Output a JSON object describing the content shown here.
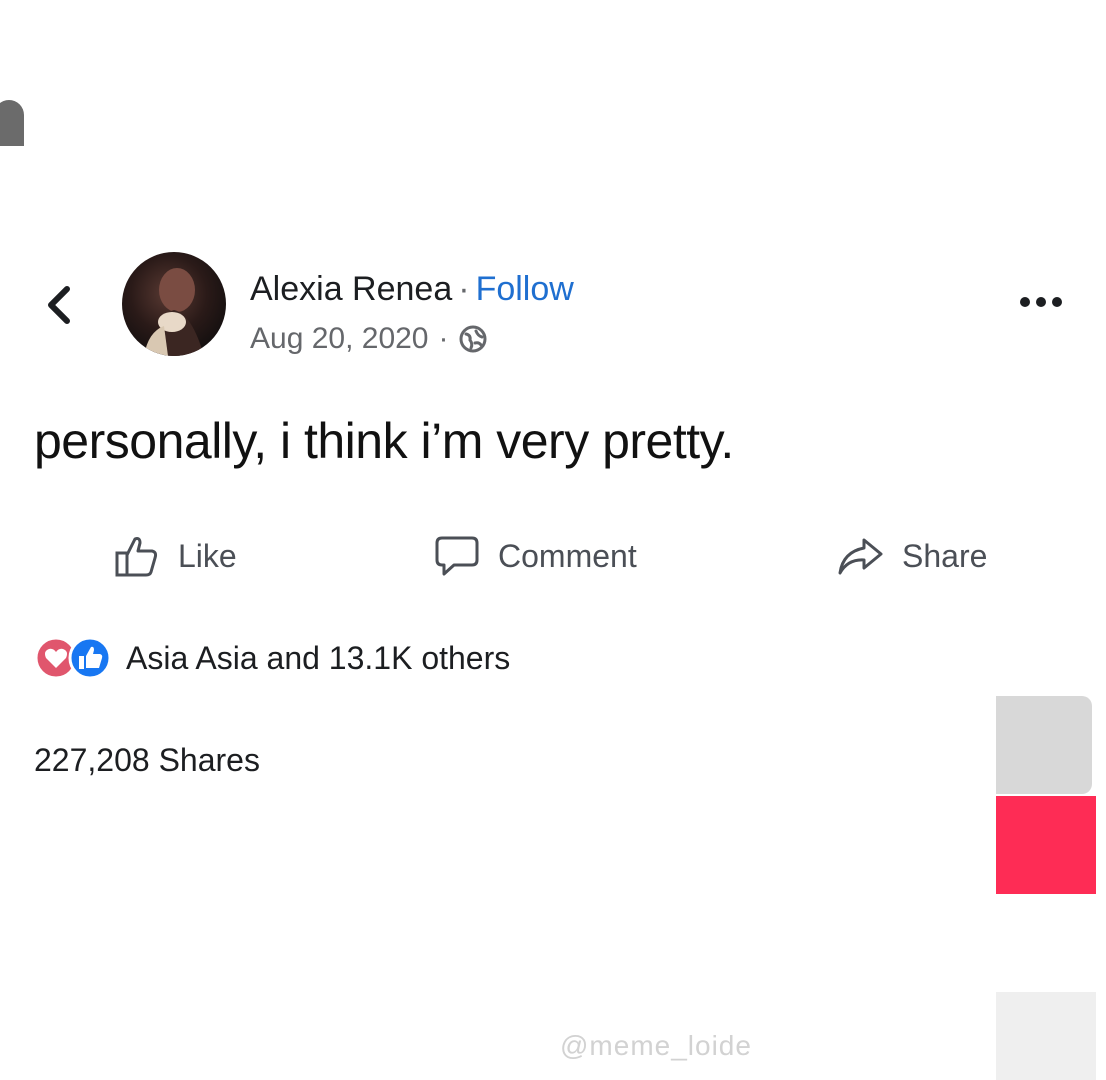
{
  "post": {
    "author": "Alexia Renea",
    "separator": "·",
    "follow_label": "Follow",
    "date": "Aug 20, 2020",
    "meta_separator": "·",
    "privacy_icon": "globe-icon",
    "text": "personally, i think i’m very pretty."
  },
  "actions": {
    "like": "Like",
    "comment": "Comment",
    "share": "Share"
  },
  "reactions": {
    "icons": [
      "love-reaction-icon",
      "like-reaction-icon"
    ],
    "summary": "Asia Asia and 13.1K others"
  },
  "shares": {
    "count_text": "227,208 Shares"
  },
  "watermark": {
    "text": "@meme_loide"
  },
  "colors": {
    "link": "#1f6fd0",
    "secondary_text": "#65676b",
    "love_red": "#e0566d",
    "like_blue": "#1877f2",
    "tiktok_pink": "#fe2c55"
  }
}
